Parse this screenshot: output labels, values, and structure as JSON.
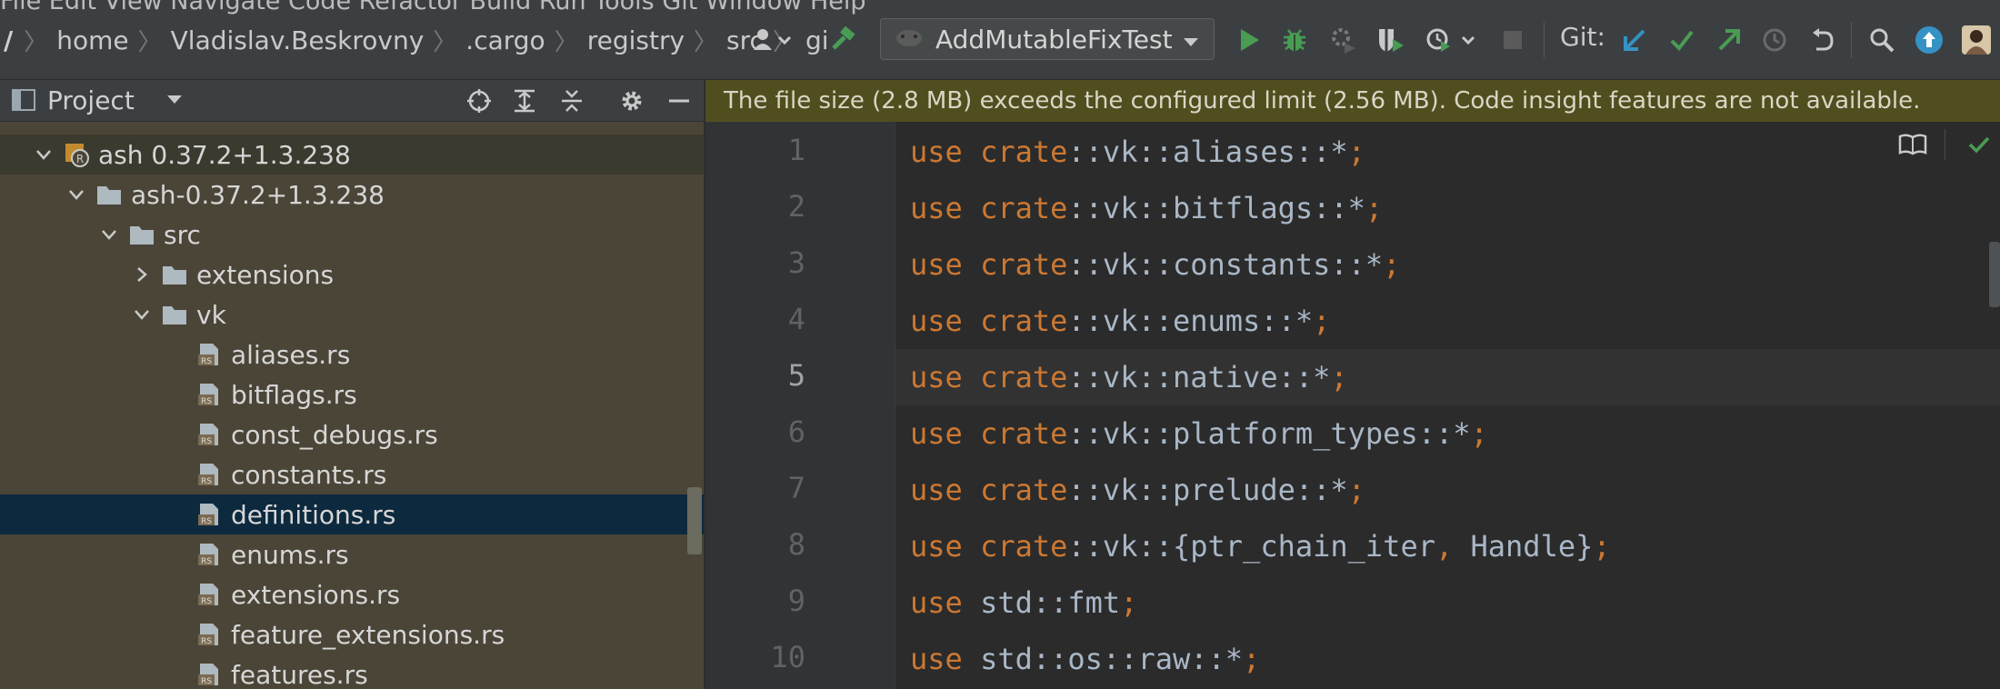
{
  "menu": {
    "text": "File  Edit  View  Navigate  Code  Refactor  Build  Run  Tools  Git  Window  Help"
  },
  "breadcrumbs": {
    "root": "/",
    "items": [
      "home",
      "Vladislav.Beskrovny",
      ".cargo",
      "registry",
      "src",
      "gi"
    ]
  },
  "toolbar": {
    "run_config": "AddMutableFixTest",
    "git_label": "Git:",
    "icons": [
      "user-icon",
      "build-hammer-icon",
      "run-icon",
      "debug-icon",
      "profile-icon",
      "coverage-icon",
      "run-with-icon",
      "stop-icon",
      "git-update-icon",
      "git-commit-icon",
      "git-push-icon",
      "history-icon",
      "rollback-icon",
      "search-icon",
      "update-icon",
      "avatar"
    ]
  },
  "project_panel": {
    "title": "Project",
    "tree": [
      {
        "label": "ash 0.37.2+1.3.238",
        "level": 1,
        "expanded": true,
        "kind": "crate"
      },
      {
        "label": "ash-0.37.2+1.3.238",
        "level": 2,
        "expanded": true,
        "kind": "folder"
      },
      {
        "label": "src",
        "level": 3,
        "expanded": true,
        "kind": "folder"
      },
      {
        "label": "extensions",
        "level": 4,
        "expanded": false,
        "kind": "folder"
      },
      {
        "label": "vk",
        "level": 4,
        "expanded": true,
        "kind": "folder"
      },
      {
        "label": "aliases.rs",
        "level": 5,
        "kind": "rs"
      },
      {
        "label": "bitflags.rs",
        "level": 5,
        "kind": "rs"
      },
      {
        "label": "const_debugs.rs",
        "level": 5,
        "kind": "rs"
      },
      {
        "label": "constants.rs",
        "level": 5,
        "kind": "rs"
      },
      {
        "label": "definitions.rs",
        "level": 5,
        "kind": "rs",
        "selected": true
      },
      {
        "label": "enums.rs",
        "level": 5,
        "kind": "rs"
      },
      {
        "label": "extensions.rs",
        "level": 5,
        "kind": "rs"
      },
      {
        "label": "feature_extensions.rs",
        "level": 5,
        "kind": "rs"
      },
      {
        "label": "features.rs",
        "level": 5,
        "kind": "rs"
      }
    ]
  },
  "editor": {
    "banner": "The file size (2.8 MB) exceeds the configured limit (2.56 MB). Code insight features are not available.",
    "current_line": 5,
    "lines": [
      {
        "n": "1",
        "tokens": [
          [
            "kw",
            "use"
          ],
          [
            "sep",
            " "
          ],
          [
            "kw",
            "crate"
          ],
          [
            "sep",
            "::"
          ],
          [
            "id",
            "vk"
          ],
          [
            "sep",
            "::"
          ],
          [
            "id",
            "aliases"
          ],
          [
            "sep",
            "::"
          ],
          [
            "id",
            "*"
          ],
          [
            "punc",
            ";"
          ]
        ]
      },
      {
        "n": "2",
        "tokens": [
          [
            "kw",
            "use"
          ],
          [
            "sep",
            " "
          ],
          [
            "kw",
            "crate"
          ],
          [
            "sep",
            "::"
          ],
          [
            "id",
            "vk"
          ],
          [
            "sep",
            "::"
          ],
          [
            "id",
            "bitflags"
          ],
          [
            "sep",
            "::"
          ],
          [
            "id",
            "*"
          ],
          [
            "punc",
            ";"
          ]
        ]
      },
      {
        "n": "3",
        "tokens": [
          [
            "kw",
            "use"
          ],
          [
            "sep",
            " "
          ],
          [
            "kw",
            "crate"
          ],
          [
            "sep",
            "::"
          ],
          [
            "id",
            "vk"
          ],
          [
            "sep",
            "::"
          ],
          [
            "id",
            "constants"
          ],
          [
            "sep",
            "::"
          ],
          [
            "id",
            "*"
          ],
          [
            "punc",
            ";"
          ]
        ]
      },
      {
        "n": "4",
        "tokens": [
          [
            "kw",
            "use"
          ],
          [
            "sep",
            " "
          ],
          [
            "kw",
            "crate"
          ],
          [
            "sep",
            "::"
          ],
          [
            "id",
            "vk"
          ],
          [
            "sep",
            "::"
          ],
          [
            "id",
            "enums"
          ],
          [
            "sep",
            "::"
          ],
          [
            "id",
            "*"
          ],
          [
            "punc",
            ";"
          ]
        ]
      },
      {
        "n": "5",
        "tokens": [
          [
            "kw",
            "use"
          ],
          [
            "sep",
            " "
          ],
          [
            "kw",
            "crate"
          ],
          [
            "sep",
            "::"
          ],
          [
            "id",
            "vk"
          ],
          [
            "sep",
            "::"
          ],
          [
            "id",
            "native"
          ],
          [
            "sep",
            "::"
          ],
          [
            "id",
            "*"
          ],
          [
            "punc",
            ";"
          ]
        ]
      },
      {
        "n": "6",
        "tokens": [
          [
            "kw",
            "use"
          ],
          [
            "sep",
            " "
          ],
          [
            "kw",
            "crate"
          ],
          [
            "sep",
            "::"
          ],
          [
            "id",
            "vk"
          ],
          [
            "sep",
            "::"
          ],
          [
            "id",
            "platform_types"
          ],
          [
            "sep",
            "::"
          ],
          [
            "id",
            "*"
          ],
          [
            "punc",
            ";"
          ]
        ]
      },
      {
        "n": "7",
        "tokens": [
          [
            "kw",
            "use"
          ],
          [
            "sep",
            " "
          ],
          [
            "kw",
            "crate"
          ],
          [
            "sep",
            "::"
          ],
          [
            "id",
            "vk"
          ],
          [
            "sep",
            "::"
          ],
          [
            "id",
            "prelude"
          ],
          [
            "sep",
            "::"
          ],
          [
            "id",
            "*"
          ],
          [
            "punc",
            ";"
          ]
        ]
      },
      {
        "n": "8",
        "tokens": [
          [
            "kw",
            "use"
          ],
          [
            "sep",
            " "
          ],
          [
            "kw",
            "crate"
          ],
          [
            "sep",
            "::"
          ],
          [
            "id",
            "vk"
          ],
          [
            "sep",
            "::"
          ],
          [
            "id",
            "{ptr_chain_iter"
          ],
          [
            "punc",
            ","
          ],
          [
            "id",
            " Handle}"
          ],
          [
            "punc",
            ";"
          ]
        ]
      },
      {
        "n": "9",
        "tokens": [
          [
            "kw",
            "use"
          ],
          [
            "sep",
            " "
          ],
          [
            "id",
            "std"
          ],
          [
            "sep",
            "::"
          ],
          [
            "id",
            "fmt"
          ],
          [
            "punc",
            ";"
          ]
        ]
      },
      {
        "n": "10",
        "tokens": [
          [
            "kw",
            "use"
          ],
          [
            "sep",
            " "
          ],
          [
            "id",
            "std"
          ],
          [
            "sep",
            "::"
          ],
          [
            "id",
            "os"
          ],
          [
            "sep",
            "::"
          ],
          [
            "id",
            "raw"
          ],
          [
            "sep",
            "::"
          ],
          [
            "id",
            "*"
          ],
          [
            "punc",
            ";"
          ]
        ]
      }
    ]
  },
  "colors": {
    "keyword": "#cc7832",
    "identifier": "#a9b7c6",
    "banner_bg": "#504e1f",
    "selection": "#0d293e",
    "run_green": "#499c54",
    "git_blue": "#3592c4"
  }
}
